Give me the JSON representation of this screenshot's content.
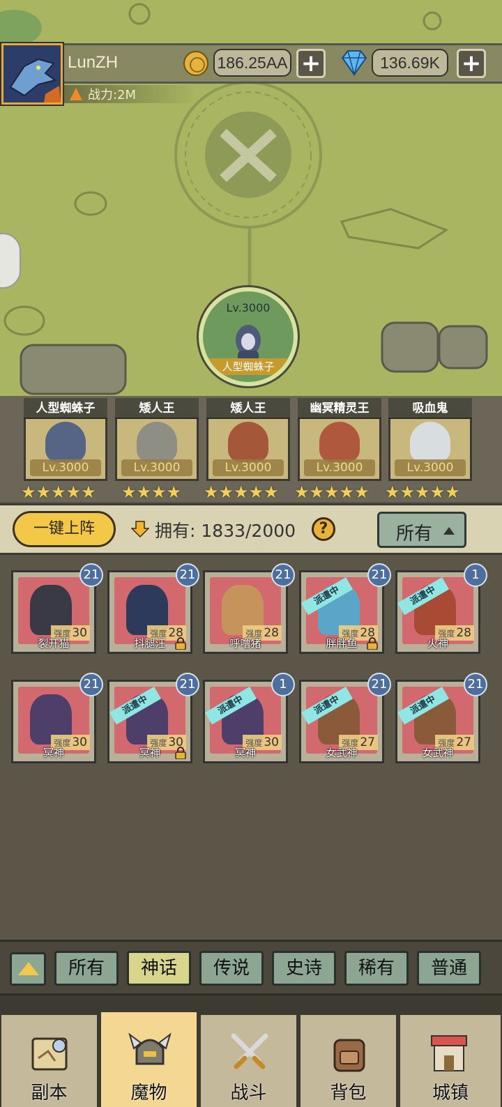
{
  "player": {
    "name": "LunZH",
    "power": "战力:2M"
  },
  "resources": {
    "gold": "186.25AA",
    "gems": "136.69K",
    "add_symbol": "+"
  },
  "current_stage": {
    "level": "Lv.3000",
    "name": "人型蜘蛛子"
  },
  "team": [
    {
      "name": "人型蜘蛛子",
      "level": "Lv.3000",
      "stars": "★★★★★"
    },
    {
      "name": "矮人王",
      "level": "Lv.3000",
      "stars": "★★★★"
    },
    {
      "name": "矮人王",
      "level": "Lv.3000",
      "stars": "★★★★★"
    },
    {
      "name": "幽冥精灵王",
      "level": "Lv.3000",
      "stars": "★★★★★"
    },
    {
      "name": "吸血鬼",
      "level": "Lv.3000",
      "stars": "★★★★★"
    }
  ],
  "extra_stars": "★★★★★",
  "toolbar": {
    "one_click": "一键上阵",
    "own_label": "拥有:",
    "own_count": "1833/2000",
    "help": "?",
    "filter_value": "所有"
  },
  "strength_label": "强度",
  "monsters": [
    {
      "name": "裂开猫",
      "strength": "30",
      "count": "21",
      "dispatched": false,
      "locked": false
    },
    {
      "name": "抖腿汪",
      "strength": "28",
      "count": "21",
      "dispatched": false,
      "locked": true
    },
    {
      "name": "呼噜猪",
      "strength": "28",
      "count": "21",
      "dispatched": false,
      "locked": false
    },
    {
      "name": "胖胖鱼",
      "strength": "28",
      "count": "21",
      "dispatched": true,
      "locked": true
    },
    {
      "name": "火神",
      "strength": "28",
      "count": "1",
      "dispatched": true,
      "locked": false
    },
    {
      "name": "冥神",
      "strength": "30",
      "count": "21",
      "dispatched": false,
      "locked": false
    },
    {
      "name": "冥神",
      "strength": "30",
      "count": "21",
      "dispatched": true,
      "locked": true
    },
    {
      "name": "冥神",
      "strength": "30",
      "count": "1",
      "dispatched": true,
      "locked": false
    },
    {
      "name": "女武神",
      "strength": "27",
      "count": "21",
      "dispatched": true,
      "locked": false
    },
    {
      "name": "女武神",
      "strength": "27",
      "count": "21",
      "dispatched": true,
      "locked": false
    }
  ],
  "dispatched_label": "派遣中",
  "tiers": [
    "所有",
    "神话",
    "传说",
    "史诗",
    "稀有",
    "普通"
  ],
  "active_tier": "神话",
  "nav": [
    "副本",
    "魔物",
    "战斗",
    "背包",
    "城镇"
  ],
  "active_nav": "魔物",
  "colors": {
    "accent": "#f3c748",
    "dispatched": "#8fe6e2",
    "count_badge": "#4e6f9e",
    "active_tab": "#f3d793"
  }
}
